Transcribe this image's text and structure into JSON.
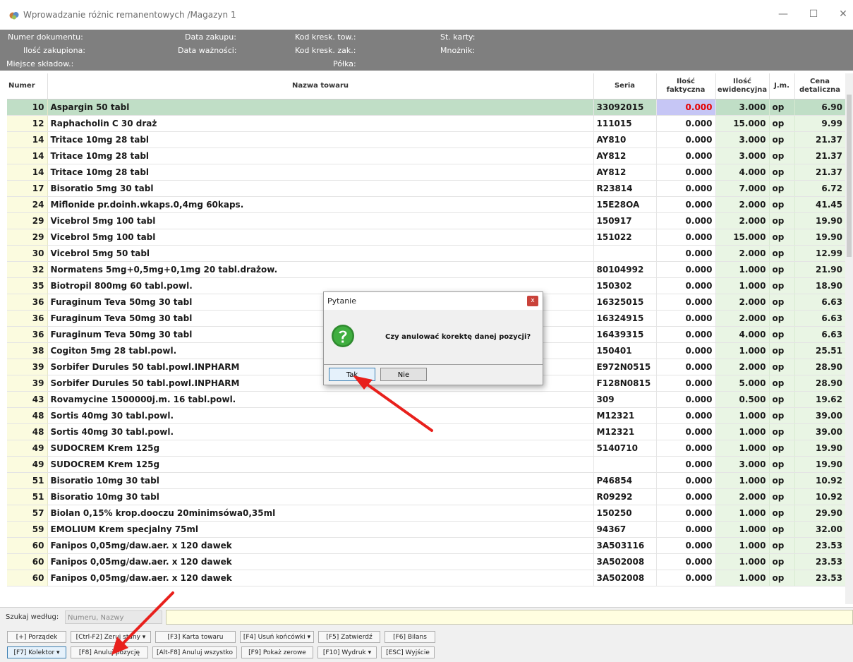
{
  "window": {
    "title": "Wprowadzanie różnic remanentowych /Magazyn 1",
    "minimize": "—",
    "maximize": "☐",
    "close": "✕"
  },
  "info": {
    "numer_dokumentu": "Numer dokumentu:",
    "ilosc_zakupiona": "Ilość zakupiona:",
    "miejsce_skladow": "Miejsce składow.:",
    "data_zakupu": "Data zakupu:",
    "data_waznosci": "Data ważności:",
    "kod_kresk_tow": "Kod kresk. tow.:",
    "kod_kresk_zak": "Kod kresk. zak.:",
    "polka": "Półka:",
    "st_karty": "St. karty:",
    "mnoznik": "Mnożnik:"
  },
  "columns": {
    "numer": "Numer",
    "nazwa": "Nazwa towaru",
    "seria": "Seria",
    "ilosc_fakt_1": "Ilość",
    "ilosc_fakt_2": "faktyczna",
    "ilosc_ewid_1": "Ilość",
    "ilosc_ewid_2": "ewidencyjna",
    "jm": "J.m.",
    "cena_1": "Cena",
    "cena_2": "detaliczna"
  },
  "rows": [
    {
      "numer": "10",
      "nazwa": "Aspargin 50 tabl",
      "seria": "33092015",
      "fakt": "0.000",
      "ewid": "3.000",
      "jm": "op",
      "cena": "6.90"
    },
    {
      "numer": "12",
      "nazwa": "Raphacholin C 30 draż",
      "seria": "111015",
      "fakt": "0.000",
      "ewid": "15.000",
      "jm": "op",
      "cena": "9.99"
    },
    {
      "numer": "14",
      "nazwa": "Tritace 10mg 28 tabl",
      "seria": "AY810",
      "fakt": "0.000",
      "ewid": "3.000",
      "jm": "op",
      "cena": "21.37"
    },
    {
      "numer": "14",
      "nazwa": "Tritace 10mg 28 tabl",
      "seria": "AY812",
      "fakt": "0.000",
      "ewid": "3.000",
      "jm": "op",
      "cena": "21.37"
    },
    {
      "numer": "14",
      "nazwa": "Tritace 10mg 28 tabl",
      "seria": "AY812",
      "fakt": "0.000",
      "ewid": "4.000",
      "jm": "op",
      "cena": "21.37"
    },
    {
      "numer": "17",
      "nazwa": "Bisoratio 5mg 30 tabl",
      "seria": "R23814",
      "fakt": "0.000",
      "ewid": "7.000",
      "jm": "op",
      "cena": "6.72"
    },
    {
      "numer": "24",
      "nazwa": "Miflonide pr.doinh.wkaps.0,4mg 60kaps.",
      "seria": "15E28OA",
      "fakt": "0.000",
      "ewid": "2.000",
      "jm": "op",
      "cena": "41.45"
    },
    {
      "numer": "29",
      "nazwa": "Vicebrol 5mg 100 tabl",
      "seria": "150917",
      "fakt": "0.000",
      "ewid": "2.000",
      "jm": "op",
      "cena": "19.90"
    },
    {
      "numer": "29",
      "nazwa": "Vicebrol 5mg 100 tabl",
      "seria": "151022",
      "fakt": "0.000",
      "ewid": "15.000",
      "jm": "op",
      "cena": "19.90"
    },
    {
      "numer": "30",
      "nazwa": "Vicebrol 5mg 50 tabl",
      "seria": "",
      "fakt": "0.000",
      "ewid": "2.000",
      "jm": "op",
      "cena": "12.99"
    },
    {
      "numer": "32",
      "nazwa": "Normatens 5mg+0,5mg+0,1mg 20 tabl.drażow.",
      "seria": "80104992",
      "fakt": "0.000",
      "ewid": "1.000",
      "jm": "op",
      "cena": "21.90"
    },
    {
      "numer": "35",
      "nazwa": "Biotropil 800mg 60 tabl.powl.",
      "seria": "150302",
      "fakt": "0.000",
      "ewid": "1.000",
      "jm": "op",
      "cena": "18.90"
    },
    {
      "numer": "36",
      "nazwa": "Furaginum Teva 50mg 30 tabl",
      "seria": "16325015",
      "fakt": "0.000",
      "ewid": "2.000",
      "jm": "op",
      "cena": "6.63"
    },
    {
      "numer": "36",
      "nazwa": "Furaginum Teva 50mg 30 tabl",
      "seria": "16324915",
      "fakt": "0.000",
      "ewid": "2.000",
      "jm": "op",
      "cena": "6.63"
    },
    {
      "numer": "36",
      "nazwa": "Furaginum Teva 50mg 30 tabl",
      "seria": "16439315",
      "fakt": "0.000",
      "ewid": "4.000",
      "jm": "op",
      "cena": "6.63"
    },
    {
      "numer": "38",
      "nazwa": "Cogiton 5mg 28 tabl.powl.",
      "seria": "150401",
      "fakt": "0.000",
      "ewid": "1.000",
      "jm": "op",
      "cena": "25.51"
    },
    {
      "numer": "39",
      "nazwa": "Sorbifer Durules 50 tabl.powl.INPHARM",
      "seria": "E972N0515",
      "fakt": "0.000",
      "ewid": "2.000",
      "jm": "op",
      "cena": "28.90"
    },
    {
      "numer": "39",
      "nazwa": "Sorbifer Durules 50 tabl.powl.INPHARM",
      "seria": "F128N0815",
      "fakt": "0.000",
      "ewid": "5.000",
      "jm": "op",
      "cena": "28.90"
    },
    {
      "numer": "43",
      "nazwa": "Rovamycine 1500000j.m. 16 tabl.powl.",
      "seria": "309",
      "fakt": "0.000",
      "ewid": "0.500",
      "jm": "op",
      "cena": "19.62"
    },
    {
      "numer": "48",
      "nazwa": "Sortis 40mg 30 tabl.powl.",
      "seria": "M12321",
      "fakt": "0.000",
      "ewid": "1.000",
      "jm": "op",
      "cena": "39.00"
    },
    {
      "numer": "48",
      "nazwa": "Sortis 40mg 30 tabl.powl.",
      "seria": "M12321",
      "fakt": "0.000",
      "ewid": "1.000",
      "jm": "op",
      "cena": "39.00"
    },
    {
      "numer": "49",
      "nazwa": "SUDOCREM Krem 125g",
      "seria": "5140710",
      "fakt": "0.000",
      "ewid": "1.000",
      "jm": "op",
      "cena": "19.90"
    },
    {
      "numer": "49",
      "nazwa": "SUDOCREM Krem 125g",
      "seria": "",
      "fakt": "0.000",
      "ewid": "3.000",
      "jm": "op",
      "cena": "19.90"
    },
    {
      "numer": "51",
      "nazwa": "Bisoratio 10mg 30 tabl",
      "seria": "P46854",
      "fakt": "0.000",
      "ewid": "1.000",
      "jm": "op",
      "cena": "10.92"
    },
    {
      "numer": "51",
      "nazwa": "Bisoratio 10mg 30 tabl",
      "seria": "R09292",
      "fakt": "0.000",
      "ewid": "2.000",
      "jm": "op",
      "cena": "10.92"
    },
    {
      "numer": "57",
      "nazwa": "Biolan 0,15% krop.dooczu 20minimsówa0,35ml",
      "seria": "150250",
      "fakt": "0.000",
      "ewid": "1.000",
      "jm": "op",
      "cena": "29.90"
    },
    {
      "numer": "59",
      "nazwa": "EMOLIUM Krem specjalny 75ml",
      "seria": "94367",
      "fakt": "0.000",
      "ewid": "1.000",
      "jm": "op",
      "cena": "32.00"
    },
    {
      "numer": "60",
      "nazwa": "Fanipos 0,05mg/daw.aer. x 120 dawek",
      "seria": "3A503116",
      "fakt": "0.000",
      "ewid": "1.000",
      "jm": "op",
      "cena": "23.53"
    },
    {
      "numer": "60",
      "nazwa": "Fanipos 0,05mg/daw.aer. x 120 dawek",
      "seria": "3A502008",
      "fakt": "0.000",
      "ewid": "1.000",
      "jm": "op",
      "cena": "23.53"
    },
    {
      "numer": "60",
      "nazwa": "Fanipos 0,05mg/daw.aer. x 120 dawek",
      "seria": "3A502008",
      "fakt": "0.000",
      "ewid": "1.000",
      "jm": "op",
      "cena": "23.53"
    }
  ],
  "search": {
    "label": "Szukaj według:",
    "mode_placeholder": "Numeru, Nazwy"
  },
  "toolbar": {
    "porzadek": "[+] Porządek",
    "zeruj": "[Ctrl-F2] Zeruj stany ▾",
    "karta": "[F3] Karta towaru",
    "usun": "[F4] Usuń końcówki ▾",
    "zatwierdz": "[F5] Zatwierdź",
    "bilans": "[F6] Bilans",
    "kolektor": "[F7] Kolektor ▾",
    "anuluj_poz": "[F8] Anuluj pozycję",
    "anuluj_wsz": "[Alt-F8] Anuluj wszystko",
    "pokaz_zerowe": "[F9] Pokaż zerowe",
    "wydruk": "[F10] Wydruk ▾",
    "wyjscie": "[ESC] Wyjście"
  },
  "dialog": {
    "title": "Pytanie",
    "close": "x",
    "message": "Czy anulować korektę danej pozycji?",
    "yes": "Tak",
    "no": "Nie"
  },
  "colors": {
    "selected_row": "#c0dec6",
    "info_bar": "#7f7f7f",
    "quantity_red": "#e60000",
    "arrow": "#e8201c"
  }
}
